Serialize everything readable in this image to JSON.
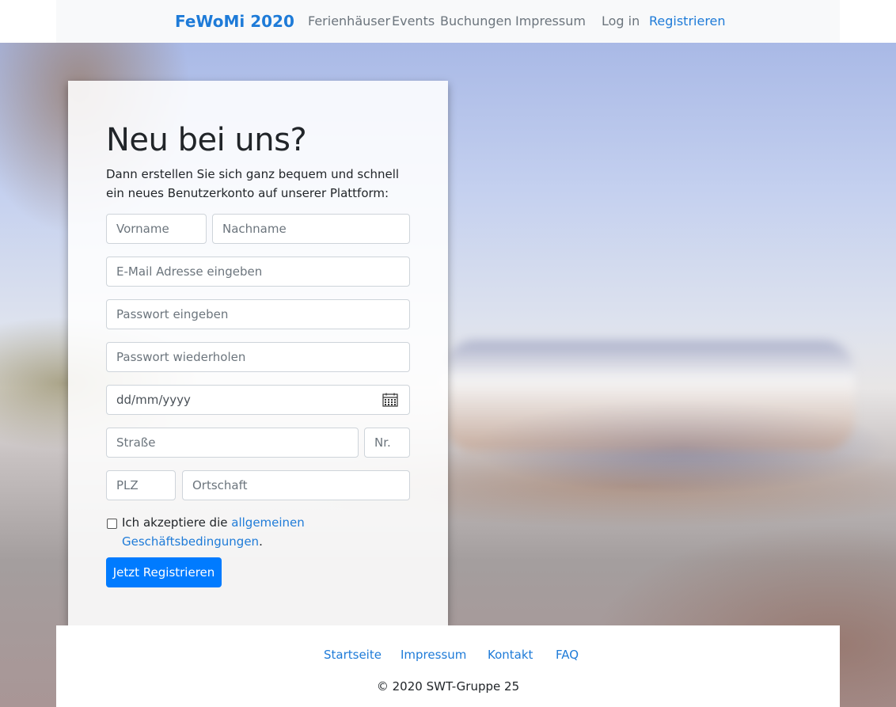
{
  "navbar": {
    "brand": "FeWoMi 2020",
    "links": [
      "Ferienhäuser",
      "Events",
      "Buchungen",
      "Impressum"
    ],
    "login": "Log in",
    "register": "Registrieren"
  },
  "card": {
    "title": "Neu bei uns?",
    "lead": "Dann erstellen Sie sich ganz bequem und schnell ein neues Benutzerkonto auf unserer Plattform:",
    "fields": {
      "firstname": "Vorname",
      "lastname": "Nachname",
      "email": "E-Mail Adresse eingeben",
      "password": "Passwort eingeben",
      "password_repeat": "Passwort wiederholen",
      "birthdate": "dd/mm/yyyy",
      "street": "Straße",
      "number": "Nr.",
      "zip": "PLZ",
      "city": "Ortschaft"
    },
    "terms_prefix": "Ich akzeptiere die",
    "terms_link_1": "allgemeinen",
    "terms_link_2": "Geschäftsbedingungen",
    "terms_suffix": ".",
    "submit": "Jetzt Registrieren"
  },
  "footer": {
    "links": [
      "Startseite",
      "Impressum",
      "Kontakt",
      "FAQ"
    ],
    "copyright": "© 2020 SWT-Gruppe 25"
  },
  "colors": {
    "primary": "#007bff",
    "link": "#1e7bd8",
    "navbar_bg": "#f8f9fa"
  }
}
